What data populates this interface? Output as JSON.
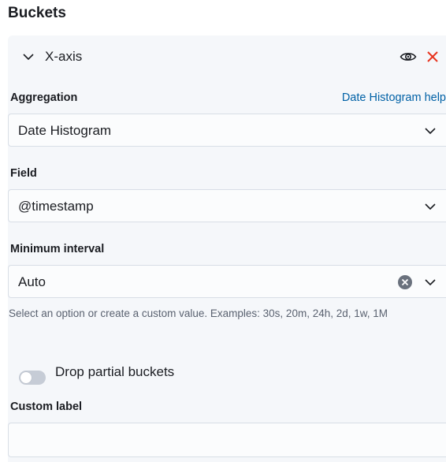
{
  "section_title": "Buckets",
  "panel": {
    "title": "X-axis",
    "icons": {
      "toggle": "chevron-down-icon",
      "visibility": "eye-icon",
      "remove": "close-icon"
    },
    "colors": {
      "remove": "#e7331e",
      "link": "#0061a6"
    }
  },
  "aggregation": {
    "label": "Aggregation",
    "help_link": "Date Histogram help",
    "value": "Date Histogram"
  },
  "field": {
    "label": "Field",
    "value": "@timestamp"
  },
  "minimum_interval": {
    "label": "Minimum interval",
    "value": "Auto",
    "helper": "Select an option or create a custom value. Examples: 30s, 20m, 24h, 2d, 1w, 1M"
  },
  "drop_partial_buckets": {
    "label": "Drop partial buckets",
    "enabled": false
  },
  "custom_label": {
    "label": "Custom label",
    "value": ""
  }
}
